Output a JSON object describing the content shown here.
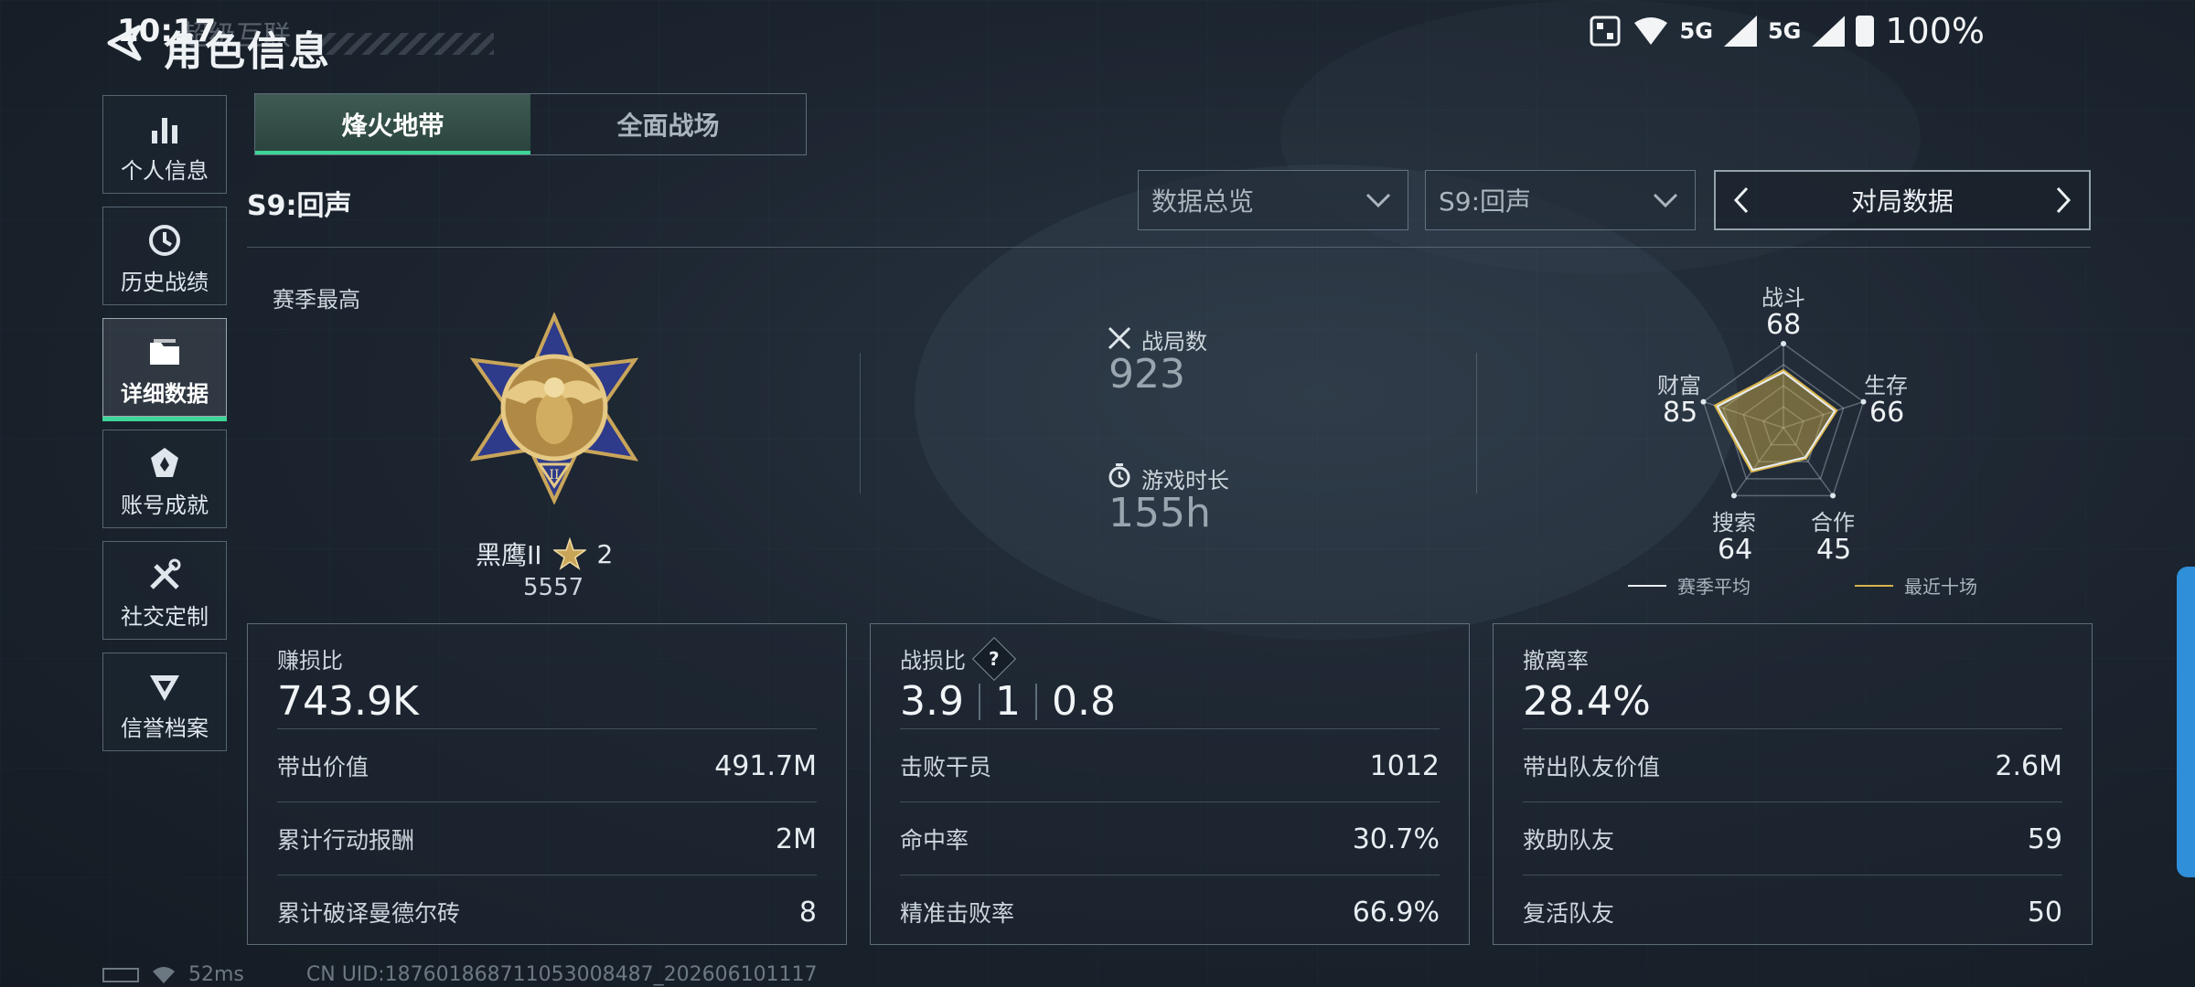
{
  "status_bar": {
    "time": "10:17",
    "ghost_text": "超级互联",
    "network_1": "5G",
    "network_2": "5G",
    "battery": "100%"
  },
  "header": {
    "title": "角色信息"
  },
  "sidebar": {
    "items": [
      {
        "label": "个人信息",
        "icon": "bar-chart-icon"
      },
      {
        "label": "历史战绩",
        "icon": "clock-icon"
      },
      {
        "label": "详细数据",
        "icon": "folder-icon",
        "active": true
      },
      {
        "label": "账号成就",
        "icon": "badge-icon"
      },
      {
        "label": "社交定制",
        "icon": "tools-icon"
      },
      {
        "label": "信誉档案",
        "icon": "emblem-icon"
      }
    ]
  },
  "tabs": [
    {
      "label": "烽火地带",
      "active": true
    },
    {
      "label": "全面战场",
      "active": false
    }
  ],
  "season_title": "S9:回声",
  "filters": {
    "overview": "数据总览",
    "season": "S9:回声",
    "nav_label": "对局数据"
  },
  "rank": {
    "section_label": "赛季最高",
    "name": "黑鹰II",
    "stars": "2",
    "score": "5557"
  },
  "summary": {
    "matches_label": "战局数",
    "matches_value": "923",
    "playtime_label": "游戏时长",
    "playtime_value": "155h"
  },
  "radar": {
    "axes": [
      {
        "label": "战斗",
        "value": "68"
      },
      {
        "label": "生存",
        "value": "66"
      },
      {
        "label": "合作",
        "value": "45"
      },
      {
        "label": "搜索",
        "value": "64"
      },
      {
        "label": "财富",
        "value": "85"
      }
    ],
    "legend_avg": "赛季平均",
    "legend_recent": "最近十场",
    "colors": {
      "avg": "#e8edf1",
      "recent": "#d8b44a"
    }
  },
  "cards": [
    {
      "label": "赚损比",
      "value": "743.9K",
      "rows": [
        {
          "label": "带出价值",
          "value": "491.7M"
        },
        {
          "label": "累计行动报酬",
          "value": "2M"
        },
        {
          "label": "累计破译曼德尔砖",
          "value": "8"
        }
      ]
    },
    {
      "label": "战损比",
      "help": "?",
      "value_parts": [
        "3.9",
        "1",
        "0.8"
      ],
      "rows": [
        {
          "label": "击败干员",
          "value": "1012"
        },
        {
          "label": "命中率",
          "value": "30.7%"
        },
        {
          "label": "精准击败率",
          "value": "66.9%"
        }
      ]
    },
    {
      "label": "撤离率",
      "value": "28.4%",
      "rows": [
        {
          "label": "带出队友价值",
          "value": "2.6M"
        },
        {
          "label": "救助队友",
          "value": "59"
        },
        {
          "label": "复活队友",
          "value": "50"
        }
      ]
    }
  ],
  "footer": {
    "ping": "52ms",
    "uid": "CN UID:187601868711053008487_202606101117"
  },
  "accent_color": "#3ed598"
}
